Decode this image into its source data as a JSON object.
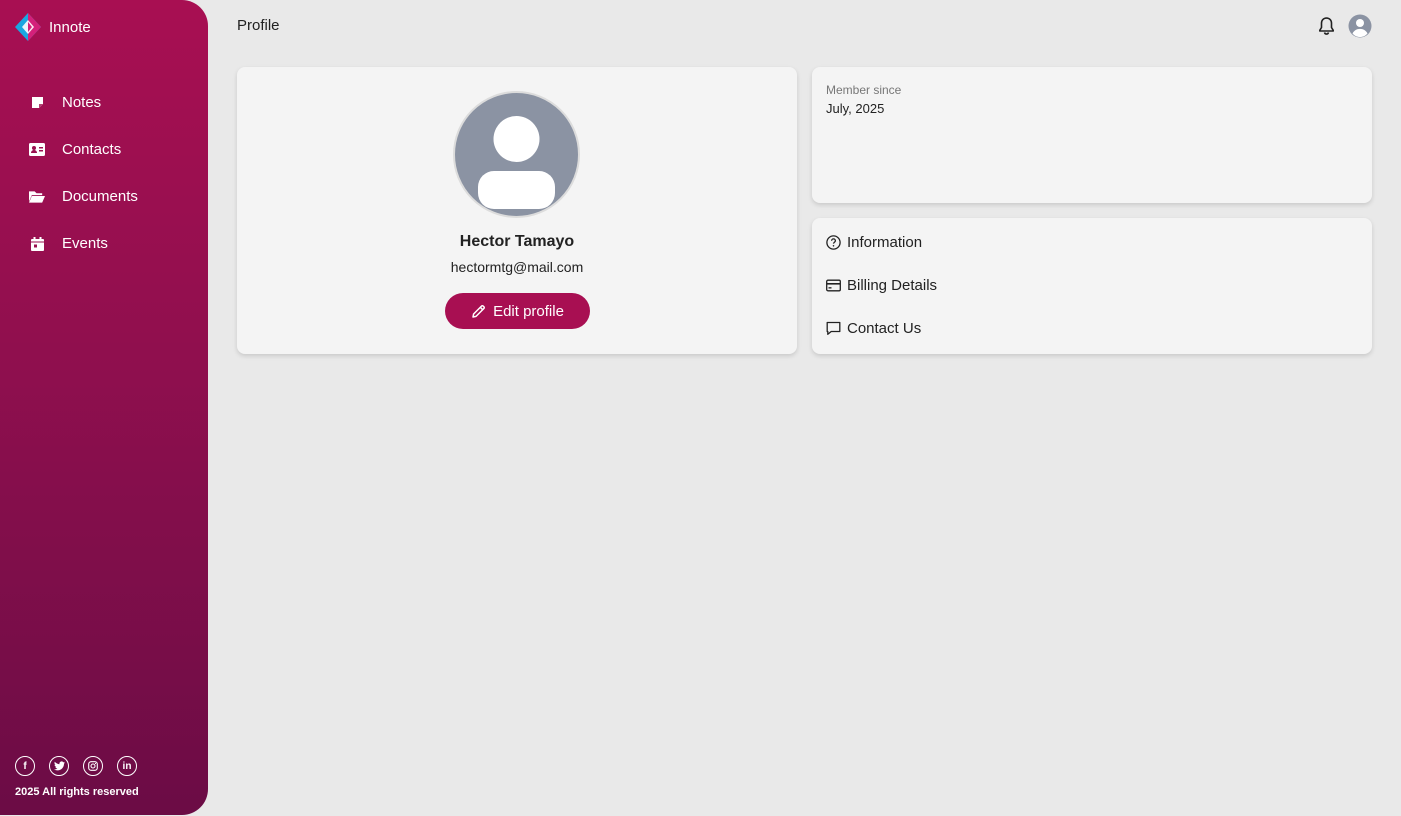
{
  "app": {
    "name": "Innote"
  },
  "sidebar": {
    "items": [
      {
        "label": "Notes",
        "icon": "sticky-note-icon"
      },
      {
        "label": "Contacts",
        "icon": "contact-card-icon"
      },
      {
        "label": "Documents",
        "icon": "folder-open-icon"
      },
      {
        "label": "Events",
        "icon": "calendar-icon"
      }
    ],
    "socials": [
      "facebook-icon",
      "twitter-icon",
      "instagram-icon",
      "linkedin-icon"
    ],
    "copyright": "2025 All rights reserved"
  },
  "header": {
    "title": "Profile"
  },
  "profile": {
    "name": "Hector Tamayo",
    "email": "hectormtg@mail.com",
    "edit_label": "Edit profile"
  },
  "member": {
    "label": "Member since",
    "value": "July, 2025"
  },
  "links": [
    {
      "label": "Information",
      "icon": "question-circle-icon"
    },
    {
      "label": "Billing Details",
      "icon": "credit-card-icon"
    },
    {
      "label": "Contact Us",
      "icon": "chat-bubble-icon"
    }
  ],
  "colors": {
    "brand": "#a80f52",
    "sidebar_top": "#a80f52",
    "sidebar_bottom": "#6b0c45",
    "background": "#e9e9e9",
    "card": "#f4f4f4",
    "avatar": "#8b93a3"
  }
}
